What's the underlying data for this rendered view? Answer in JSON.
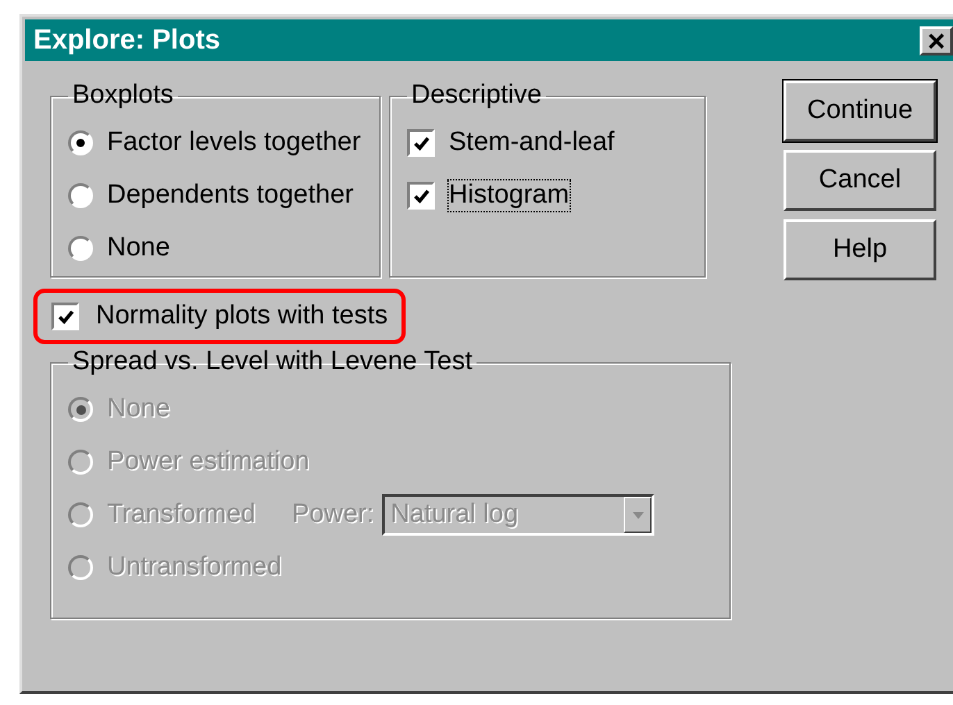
{
  "window": {
    "title": "Explore: Plots",
    "close": "×"
  },
  "boxplots": {
    "title": "Boxplots",
    "options": [
      {
        "label": "Factor levels together",
        "selected": true
      },
      {
        "label": "Dependents together",
        "selected": false
      },
      {
        "label": "None",
        "selected": false
      }
    ]
  },
  "descriptive": {
    "title": "Descriptive",
    "options": [
      {
        "label": "Stem-and-leaf",
        "checked": true,
        "focused": false
      },
      {
        "label": "Histogram",
        "checked": true,
        "focused": true
      }
    ]
  },
  "normality": {
    "label": "Normality plots with tests",
    "checked": true,
    "highlighted": true
  },
  "spread": {
    "title": "Spread vs. Level with Levene Test",
    "disabled": true,
    "options": [
      {
        "label": "None",
        "selected": true
      },
      {
        "label": "Power estimation",
        "selected": false
      },
      {
        "label": "Transformed",
        "selected": false
      },
      {
        "label": "Untransformed",
        "selected": false
      }
    ],
    "power": {
      "label": "Power:",
      "value": "Natural log"
    }
  },
  "buttons": [
    {
      "label": "Continue",
      "default": true
    },
    {
      "label": "Cancel",
      "default": false
    },
    {
      "label": "Help",
      "default": false
    }
  ]
}
